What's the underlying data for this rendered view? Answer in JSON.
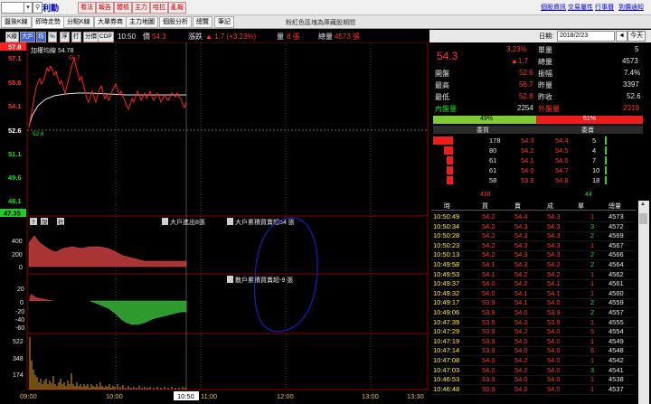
{
  "toolbar": {
    "stock_name": "利勤",
    "buttons": [
      "看法",
      "報告",
      "體檢",
      "主力",
      "哈拉",
      "亂報"
    ],
    "links": [
      "個股資訊",
      "交易屬性",
      "行事曆",
      "到價通知"
    ]
  },
  "tabs": [
    "盤後K線",
    "即時走勢",
    "分點K線",
    "大單券商",
    "主力地圖",
    "個股分析",
    "總覽",
    "筆記"
  ],
  "active_tab": 1,
  "tab_info": "粉紅色區塊為庫藏股期間",
  "chart_toolbar": {
    "buttons": [
      "K線",
      "大戶",
      "均",
      "%",
      "浮",
      "打",
      "分價",
      "CDP"
    ],
    "time": "10:50",
    "price_label": "價",
    "price": "54.3",
    "change_label": "漲跌",
    "change": "▲ 1.7 (+3.23%)",
    "volume_label": "量",
    "volume": "8 張",
    "total_label": "總量",
    "total": "4573 張"
  },
  "price_panel": {
    "ma_label": "加權均線 54.78",
    "high_marker": "56.7",
    "low_marker": "52.8",
    "price_ticks": [
      "57.8",
      "57.1",
      "55.6",
      "54.1",
      "52.6",
      "51.1",
      "49.6",
      "48.1",
      "47.35"
    ],
    "colors": {
      "price_line": "#ff2020",
      "avg_line": "#e6e6e6",
      "limit_up": "#ff2020",
      "limit_down": "#22cc22"
    }
  },
  "big_trader_panel": {
    "buttons": [
      "?",
      "說",
      "社"
    ],
    "label1": "大戶進出8張",
    "label2": "大戶累積買賣超54 張",
    "ticks": [
      "400",
      "200",
      "0"
    ]
  },
  "retail_panel": {
    "label": "散戶累積買賣超-9 張",
    "ticks": [
      "20",
      "0",
      "-20",
      "-40",
      "-60"
    ]
  },
  "volume_panel": {
    "ticks": [
      "522",
      "348",
      "174"
    ]
  },
  "time_axis": [
    "09:00",
    "10:00",
    "10:50",
    "11:00",
    "12:00",
    "13:00",
    "13:30"
  ],
  "right_panel": {
    "date_label": "日期:",
    "date": "2018/2/23",
    "btn_prev": "◄",
    "btn_next": "►",
    "btn_today": "今天",
    "price": "54.3",
    "change_pct": "3.23%",
    "change": "▲1.7",
    "single_vol_label": "單量",
    "single_vol": "5",
    "total_vol_label": "總量",
    "total_vol": "4573",
    "stats": [
      {
        "label": "開盤",
        "value": "52.6",
        "label2": "振幅",
        "value2": "7.4%"
      },
      {
        "label": "最高",
        "value": "56.7",
        "label2": "昨量",
        "value2": "3397"
      },
      {
        "label": "最低",
        "value": "52.8",
        "label2": "昨收",
        "value2": "52.6"
      }
    ],
    "inner_label": "內盤量",
    "inner": "2254",
    "outer_label": "外盤量",
    "outer": "2319",
    "pct_buy": "49%",
    "pct_sell": "51%",
    "bid_header": "委買",
    "ask_header": "委賣",
    "orderbook": [
      {
        "bid_vol": "178",
        "bid": "54.3",
        "ask": "54.4",
        "ask_vol": "5",
        "bidf": 1.0,
        "askf": 0.03
      },
      {
        "bid_vol": "80",
        "bid": "54.2",
        "ask": "54.5",
        "ask_vol": "4",
        "bidf": 0.45,
        "askf": 0.025
      },
      {
        "bid_vol": "61",
        "bid": "54.1",
        "ask": "54.6",
        "ask_vol": "7",
        "bidf": 0.34,
        "askf": 0.04
      },
      {
        "bid_vol": "61",
        "bid": "54.0",
        "ask": "54.7",
        "ask_vol": "10",
        "bidf": 0.34,
        "askf": 0.06
      },
      {
        "bid_vol": "58",
        "bid": "53.9",
        "ask": "54.8",
        "ask_vol": "18",
        "bidf": 0.32,
        "askf": 0.1
      }
    ],
    "bid_total": "438",
    "ask_total": "44",
    "tick_headers": [
      "時",
      "買",
      "賣",
      "成",
      "單",
      "總量"
    ],
    "ticks": [
      [
        "10:50:49",
        "54.2",
        "54.4",
        "54.3",
        "1",
        "4573"
      ],
      [
        "10:50:34",
        "54.2",
        "54.3",
        "54.3",
        "3",
        "4572"
      ],
      [
        "10:50:28",
        "54.2",
        "54.3",
        "54.3",
        "2",
        "4569"
      ],
      [
        "10:50:23",
        "54.2",
        "54.3",
        "54.3",
        "1",
        "4567"
      ],
      [
        "10:50:13",
        "54.2",
        "54.3",
        "54.3",
        "2",
        "4566"
      ],
      [
        "10:49:58",
        "54.1",
        "54.3",
        "54.2",
        "2",
        "4564"
      ],
      [
        "10:49:53",
        "54.1",
        "54.2",
        "54.2",
        "1",
        "4562"
      ],
      [
        "10:49:37",
        "54.0",
        "54.2",
        "54.1",
        "1",
        "4561"
      ],
      [
        "10:49:32",
        "54.0",
        "54.1",
        "54.1",
        "1",
        "4560"
      ],
      [
        "10:49:17",
        "53.9",
        "54.1",
        "54.0",
        "2",
        "4559"
      ],
      [
        "10:49:06",
        "53.9",
        "54.0",
        "53.9",
        "2",
        "4557"
      ],
      [
        "10:47:39",
        "53.9",
        "54.2",
        "53.9",
        "1",
        "4555"
      ],
      [
        "10:47:29",
        "53.9",
        "54.2",
        "54.0",
        "5",
        "4554"
      ],
      [
        "10:47:19",
        "53.9",
        "54.0",
        "54.0",
        "1",
        "4549"
      ],
      [
        "10:47:14",
        "53.9",
        "54.0",
        "54.0",
        "6",
        "4548"
      ],
      [
        "10:47:08",
        "54.0",
        "54.2",
        "54.0",
        "1",
        "4542"
      ],
      [
        "10:47:03",
        "54.0",
        "54.2",
        "54.0",
        "3",
        "4541"
      ],
      [
        "10:46:53",
        "53.9",
        "54.0",
        "54.0",
        "1",
        "4538"
      ],
      [
        "10:46:48",
        "53.9",
        "54.0",
        "54.0",
        "1",
        "4537"
      ]
    ]
  }
}
